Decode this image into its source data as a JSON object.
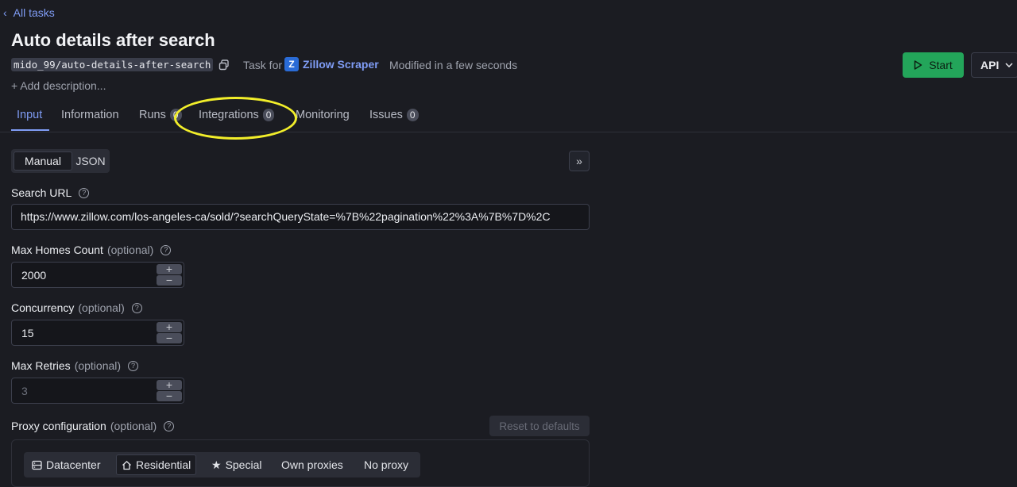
{
  "nav": {
    "back_label": "All tasks"
  },
  "header": {
    "title": "Auto details after search",
    "slug": "mido_99/auto-details-after-search",
    "task_for_label": "Task for",
    "actor_logo_letter": "Z",
    "actor_name": "Zillow Scraper",
    "modified_text": "Modified in a few seconds",
    "add_description": "+ Add description...",
    "start_label": "Start",
    "api_label": "API"
  },
  "tabs": [
    {
      "label": "Input",
      "badge": null
    },
    {
      "label": "Information",
      "badge": null
    },
    {
      "label": "Runs",
      "badge": "0"
    },
    {
      "label": "Integrations",
      "badge": "0"
    },
    {
      "label": "Monitoring",
      "badge": null
    },
    {
      "label": "Issues",
      "badge": "0"
    }
  ],
  "mode_toggle": {
    "manual": "Manual",
    "json": "JSON"
  },
  "expand_label": "»",
  "fields": {
    "search_url": {
      "label": "Search URL",
      "value": "https://www.zillow.com/los-angeles-ca/sold/?searchQueryState=%7B%22pagination%22%3A%7B%7D%2C"
    },
    "max_homes": {
      "label": "Max Homes Count",
      "optional": "(optional)",
      "value": "2000"
    },
    "concurrency": {
      "label": "Concurrency",
      "optional": "(optional)",
      "value": "15"
    },
    "max_retries": {
      "label": "Max Retries",
      "optional": "(optional)",
      "placeholder": "3"
    },
    "proxy": {
      "label": "Proxy configuration",
      "optional": "(optional)",
      "reset_label": "Reset to defaults",
      "options": [
        "Datacenter",
        "Residential",
        "Special",
        "Own proxies",
        "No proxy"
      ],
      "selected": "Residential"
    }
  },
  "stepper": {
    "plus": "+",
    "minus": "−"
  },
  "help_glyph": "?",
  "colors": {
    "accent": "#7f9cf5",
    "start_green": "#23a55a",
    "highlight": "#f2ee2a"
  }
}
